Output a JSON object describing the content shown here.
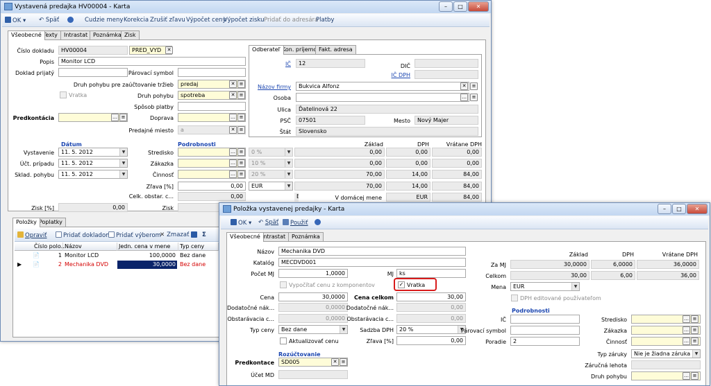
{
  "main_window": {
    "title": "Vystavená predajka HV00004 - Karta",
    "toolbar": {
      "ok": "OK",
      "back": "Späť",
      "foreign_currency": "Cudzie meny",
      "correction": "Korekcia",
      "cancel_discount": "Zrušiť zľavu",
      "calc_prices": "Výpočet ceny",
      "calc_profit": "Výpočet zisku",
      "add_to_address": "Pridať do adresára",
      "payments": "Platby"
    },
    "tabs": [
      "Všeobecné",
      "Texty",
      "Intrastat",
      "Poznámka",
      "Zisk"
    ],
    "form": {
      "doc_number_label": "Číslo dokladu",
      "doc_number": "HV00004",
      "doc_type": "PRED_VYD",
      "desc_label": "Popis",
      "desc": "Monitor LCD",
      "received_doc_label": "Doklad prijatý",
      "pair_symbol_label": "Párovací symbol",
      "movement_type_receipts_label": "Druh pohybu pre zaúčtovanie tržieb",
      "movement_type_receipts": "predaj",
      "return_label": "Vratka",
      "movement_type_label": "Druh pohybu",
      "movement_type": "spotreba",
      "payment_method_label": "Spôsob platby",
      "precontation_label": "Predkontácia",
      "transport_label": "Doprava",
      "sales_place_label": "Predajné miesto",
      "sales_place": "a",
      "date_header": "Dátum",
      "issue_label": "Vystavenie",
      "issue_date": "11. 5. 2012",
      "acc_date_label": "Účt. prípadu",
      "acc_date": "11. 5. 2012",
      "stock_date_label": "Sklad. pohybu",
      "stock_date": "11. 5. 2012",
      "details_header": "Podrobnosti",
      "center_label": "Stredisko",
      "order_label": "Zákazka",
      "activity_label": "Činnosť",
      "discount_label": "Zľava [%]",
      "discount": "0,00",
      "total_purchase_label": "Celk. obstar. c...",
      "total_purchase": "0,00",
      "profit_pct_label": "Zisk [%]",
      "profit_pct": "0,00",
      "profit_label": "Zisk",
      "vat_rates": [
        "0 %",
        "10 %",
        "20 %"
      ],
      "currency": "EUR",
      "summary_headers": [
        "Základ",
        "DPH",
        "Vrátane DPH"
      ],
      "summary_rows": [
        [
          "0,00",
          "0,00",
          "0,00"
        ],
        [
          "0,00",
          "0,00",
          "0,00"
        ],
        [
          "70,00",
          "14,00",
          "84,00"
        ]
      ],
      "summary_total": [
        "70,00",
        "14,00",
        "84,00"
      ],
      "domestic_label": "V domácej mene",
      "domestic_row": [
        "EUR",
        "EUR",
        "84,00"
      ]
    },
    "partner": {
      "tabs": [
        "Odberateľ",
        "Kon. príjemca",
        "Fakt. adresa"
      ],
      "ico_label": "IČ",
      "ico": "12",
      "dic_label": "DIČ",
      "icdph_label": "IČ DPH",
      "company_label": "Názov firmy",
      "company": "Bukvica Alfonz",
      "person_label": "Osoba",
      "street_label": "Ulica",
      "street": "Ďatelinová 22",
      "zip_label": "PSČ",
      "zip": "07501",
      "city_label": "Mesto",
      "city": "Nový Majer",
      "country_label": "Štát",
      "country": "Slovensko"
    },
    "items": {
      "tabs": [
        "Položky",
        "Poplatky"
      ],
      "toolbar": {
        "edit": "Opraviť",
        "add_doc": "Pridať dokladom",
        "add_sel": "Pridať výberom",
        "delete": "Zmazať"
      },
      "columns": [
        "Číslo polo...",
        "Názov",
        "Jedn. cena v mene",
        "Typ ceny"
      ],
      "rows": [
        {
          "num": "1",
          "name": "Monitor LCD",
          "price": "100,0000",
          "type": "Bez dane"
        },
        {
          "num": "2",
          "name": "Mechanika DVD",
          "price": "30,0000",
          "type": "Bez dane"
        }
      ]
    }
  },
  "item_window": {
    "title": "Položka vystavenej predajky - Karta",
    "toolbar": {
      "ok": "OK",
      "back": "Späť",
      "use": "Použiť"
    },
    "tabs": [
      "Všeobecné",
      "Intrastat",
      "Poznámka"
    ],
    "form": {
      "name_label": "Názov",
      "name": "Mechanika DVD",
      "catalog_label": "Katalóg",
      "catalog": "MECDVD001",
      "qty_label": "Počet MJ",
      "qty": "1,0000",
      "unit_label": "MJ",
      "unit": "ks",
      "calc_from_components": "Vypočítať cenu z komponentov",
      "return_label": "Vratka",
      "price_label": "Cena",
      "price": "30,0000",
      "total_label": "Cena celkom",
      "total": "30,00",
      "extra_cost_label": "Dodatočné nák...",
      "extra_cost": "0,0000",
      "extra_cost2_label": "Dodatočné nák...",
      "extra_cost2": "0,00",
      "purchase_label": "Obstarávacia c...",
      "purchase": "0,0000",
      "purchase2_label": "Obstarávacia c...",
      "purchase2": "0,00",
      "price_type_label": "Typ ceny",
      "price_type": "Bez dane",
      "vat_rate_label": "Sadzba DPH",
      "vat_rate": "20 %",
      "update_price_label": "Aktualizovať cenu",
      "discount_label": "Zľava [%]",
      "discount": "0,00",
      "summary_headers": [
        "Základ",
        "DPH",
        "Vrátane DPH"
      ],
      "per_unit_label": "Za MJ",
      "per_unit": [
        "30,0000",
        "6,0000",
        "36,0000"
      ],
      "total_row_label": "Celkom",
      "total_row": [
        "30,00",
        "6,00",
        "36,00"
      ],
      "currency_label": "Mena",
      "currency": "EUR",
      "vat_editable_label": "DPH editované používateľom",
      "details_header": "Podrobnosti",
      "ic_label": "IČ",
      "pair_label": "Párovací symbol",
      "order_label": "Poradie",
      "order": "2",
      "center_label": "Stredisko",
      "contract_label": "Zákazka",
      "activity_label": "Činnosť",
      "warranty_label": "Typ záruky",
      "warranty": "Nie je žiadna záruka",
      "warranty_period_label": "Záručná lehota",
      "movement_label": "Druh pohybu",
      "accounting_header": "Rozúčtovanie",
      "precont_label": "Predkontace",
      "precont": "SD005",
      "acc_md_label": "Účet MD"
    }
  },
  "colors": {
    "required_field": "#fefcd8",
    "link": "#1a45b0",
    "return_highlight": "#d81b1b"
  }
}
